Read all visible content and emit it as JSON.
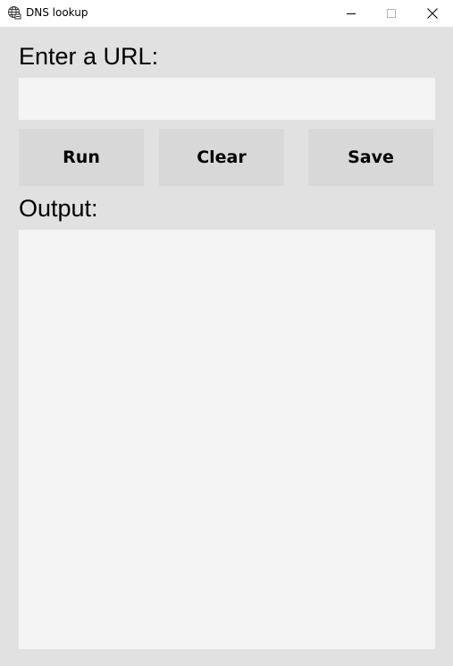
{
  "window": {
    "title": "DNS lookup",
    "icon": "globe-icon",
    "controls": {
      "minimize": "minimize-icon",
      "maximize": "maximize-icon",
      "close": "close-icon"
    }
  },
  "form": {
    "url_label": "Enter a URL:",
    "url_value": "",
    "url_placeholder": "",
    "buttons": {
      "run": "Run",
      "clear": "Clear",
      "save": "Save"
    },
    "output_label": "Output:",
    "output_value": ""
  },
  "colors": {
    "client_background": "#e1e1e1",
    "field_background": "#f4f4f4",
    "button_background": "#d8d8d8",
    "titlebar_background": "#ffffff"
  }
}
